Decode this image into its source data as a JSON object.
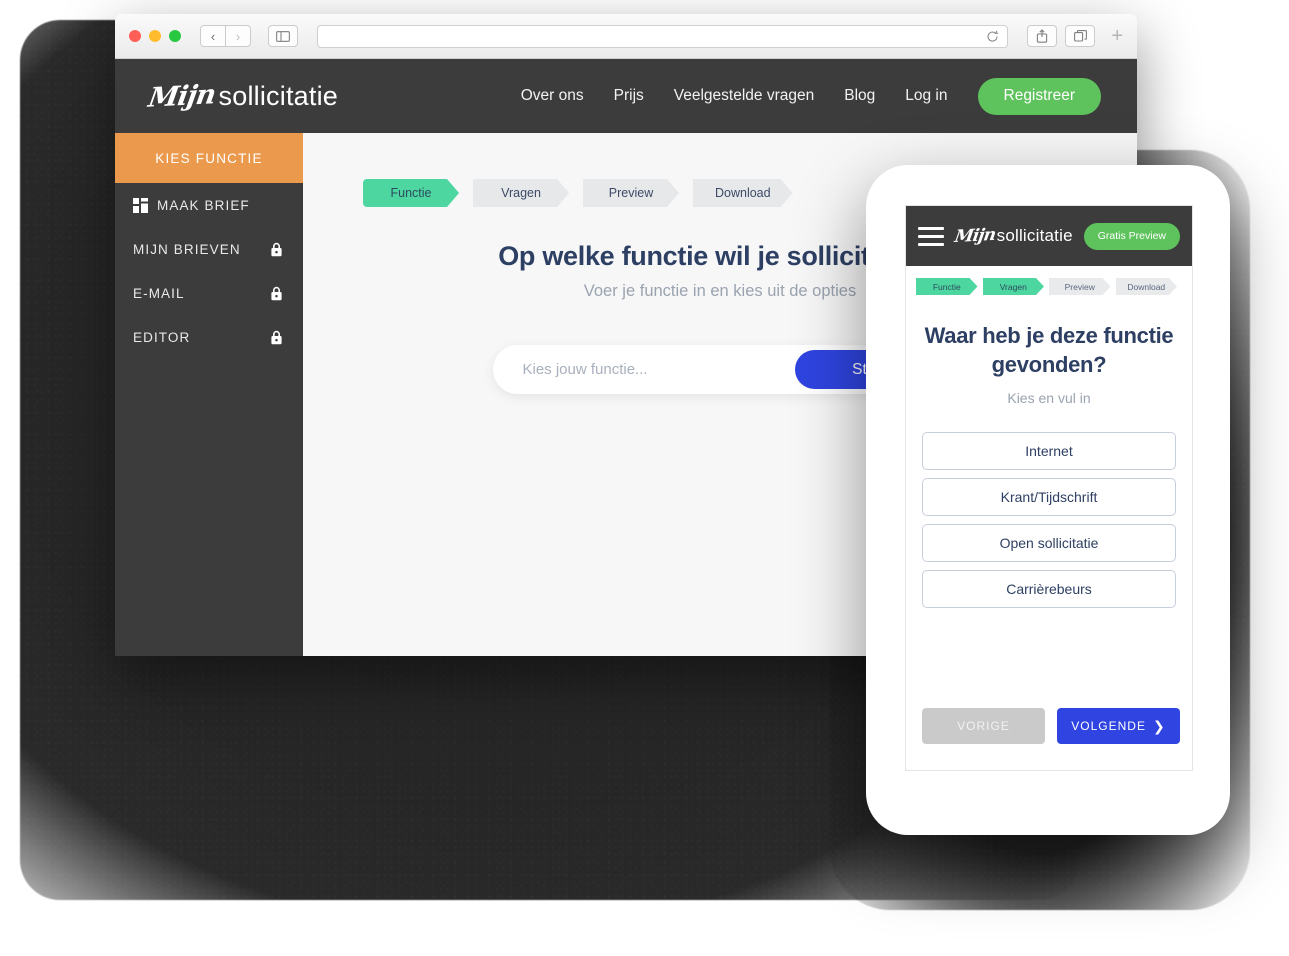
{
  "browser": {
    "back_icon": "‹",
    "forward_icon": "›",
    "sidebar_icon": "▯",
    "url_value": "",
    "url_placeholder": "",
    "reload_icon": "reload-icon",
    "share_icon": "share-icon",
    "tabs_icon": "tabs-icon",
    "new_tab_icon": "+"
  },
  "site_header": {
    "logo_script": "Mijn",
    "logo_word": "sollicitatie",
    "nav": [
      {
        "label": "Over ons"
      },
      {
        "label": "Prijs"
      },
      {
        "label": "Veelgestelde vragen"
      },
      {
        "label": "Blog"
      },
      {
        "label": "Log in"
      }
    ],
    "register_label": "Registreer",
    "register_color": "#5fc35d"
  },
  "sidebar": {
    "active_label": "KIES FUNCTIE",
    "active_color": "#eb9a4d",
    "items": [
      {
        "label": "MAAK BRIEF",
        "icon": "grid-icon",
        "locked": false
      },
      {
        "label": "MIJN BRIEVEN",
        "icon": "lock-icon",
        "locked": true
      },
      {
        "label": "E-MAIL",
        "icon": "lock-icon",
        "locked": true
      },
      {
        "label": "EDITOR",
        "icon": "lock-icon",
        "locked": true
      }
    ]
  },
  "desktop": {
    "stepper": [
      {
        "label": "Functie",
        "state": "done"
      },
      {
        "label": "Vragen",
        "state": "todo"
      },
      {
        "label": "Preview",
        "state": "todo"
      },
      {
        "label": "Download",
        "state": "todo"
      }
    ],
    "heading": "Op welke functie wil je solliciteren?",
    "subheading": "Voer je functie in en kies uit de opties",
    "search_value": "",
    "search_placeholder": "Kies jouw functie...",
    "start_label": "Start",
    "start_color": "#2f44e0",
    "accent_green": "#4dd6a0",
    "heading_color": "#2d3f63"
  },
  "phone": {
    "header": {
      "menu_icon": "hamburger-icon",
      "logo_script": "Mijn",
      "logo_word": "sollicitatie",
      "preview_label": "Gratis Preview"
    },
    "stepper": [
      {
        "label": "Functie",
        "state": "done"
      },
      {
        "label": "Vragen",
        "state": "done"
      },
      {
        "label": "Preview",
        "state": "todo"
      },
      {
        "label": "Download",
        "state": "todo"
      }
    ],
    "heading": "Waar heb je deze functie gevonden?",
    "subheading": "Kies en vul in",
    "options": [
      {
        "label": "Internet"
      },
      {
        "label": "Krant/Tijdschrift"
      },
      {
        "label": "Open sollicitatie"
      },
      {
        "label": "Carrièrebeurs"
      }
    ],
    "prev_label": "VORIGE",
    "next_label": "VOLGENDE",
    "next_icon": "❯",
    "next_color": "#2f44e0",
    "prev_color": "#cacaca"
  }
}
